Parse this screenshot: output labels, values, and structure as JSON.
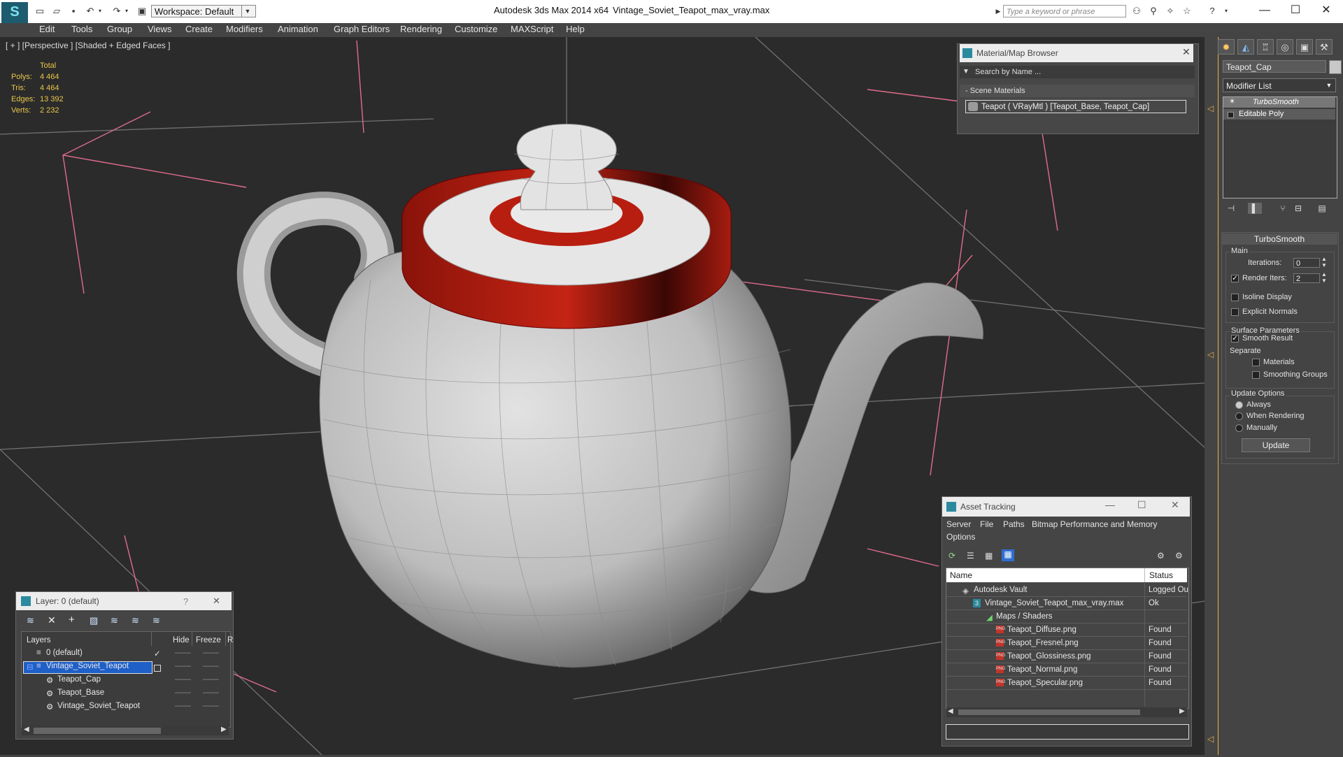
{
  "titlebar": {
    "workspace": "Workspace: Default",
    "app_title": "Autodesk 3ds Max  2014 x64",
    "file_title": "Vintage_Soviet_Teapot_max_vray.max",
    "search_placeholder": "Type a keyword or phrase",
    "minimize": "—",
    "maximize": "☐",
    "close": "✕"
  },
  "menu": [
    "Edit",
    "Tools",
    "Group",
    "Views",
    "Create",
    "Modifiers",
    "Animation",
    "Graph Editors",
    "Rendering",
    "Customize",
    "MAXScript",
    "Help"
  ],
  "viewport": {
    "label": "[ + ] [Perspective ] [Shaded + Edged Faces ]",
    "stats_header": "Total",
    "stats": [
      {
        "label": "Polys:",
        "value": "4 464"
      },
      {
        "label": "Tris:",
        "value": "4 464"
      },
      {
        "label": "Edges:",
        "value": "13 392"
      },
      {
        "label": "Verts:",
        "value": "2 232"
      }
    ],
    "colors": {
      "background": "#2b2b2b",
      "grid": "#a8a8a8",
      "rim": "#a81c10",
      "helper": "#e06c8c"
    }
  },
  "material_browser": {
    "title": "Material/Map Browser",
    "search": "Search by Name ...",
    "section": "- Scene Materials",
    "item": "Teapot  ( VRayMtl )  [Teapot_Base, Teapot_Cap]"
  },
  "command_panel": {
    "object_name": "Teapot_Cap",
    "modifier_list": "Modifier List",
    "stack": [
      "TurboSmooth",
      "Editable Poly"
    ],
    "rollout_title": "TurboSmooth",
    "main_group": "Main",
    "iterations_label": "Iterations:",
    "iterations_value": "0",
    "render_iters_label": "Render Iters:",
    "render_iters_value": "2",
    "isoline_display": "Isoline Display",
    "explicit_normals": "Explicit Normals",
    "surface_params": "Surface Parameters",
    "smooth_result": "Smooth Result",
    "separate": "Separate",
    "materials": "Materials",
    "smoothing_groups": "Smoothing Groups",
    "update_options": "Update Options",
    "always": "Always",
    "when_rendering": "When Rendering",
    "manually": "Manually",
    "update": "Update",
    "checked": {
      "render_iters": true,
      "isoline_display": false,
      "explicit_normals": false,
      "smooth_result": true,
      "materials": false,
      "smoothing_groups": false
    },
    "update_option_selected": "Always"
  },
  "asset_tracking": {
    "title": "Asset Tracking",
    "menus": [
      "Server",
      "File",
      "Paths",
      "Bitmap Performance and Memory"
    ],
    "menu_options": "Options",
    "columns": {
      "name": "Name",
      "status": "Status"
    },
    "rows": [
      {
        "name": "Autodesk Vault",
        "status": "Logged Ou"
      },
      {
        "name": "Vintage_Soviet_Teapot_max_vray.max",
        "status": "Ok"
      },
      {
        "name": "Maps / Shaders",
        "status": ""
      },
      {
        "name": "Teapot_Diffuse.png",
        "status": "Found"
      },
      {
        "name": "Teapot_Fresnel.png",
        "status": "Found"
      },
      {
        "name": "Teapot_Glossiness.png",
        "status": "Found"
      },
      {
        "name": "Teapot_Normal.png",
        "status": "Found"
      },
      {
        "name": "Teapot_Specular.png",
        "status": "Found"
      }
    ]
  },
  "layers": {
    "title": "Layer: 0 (default)",
    "help": "?",
    "close": "✕",
    "columns": {
      "layers": "Layers",
      "hide": "Hide",
      "freeze": "Freeze",
      "render": "R"
    },
    "rows": [
      {
        "name": "0 (default)",
        "selected": false
      },
      {
        "name": "Vintage_Soviet_Teapot",
        "selected": true
      },
      {
        "name": "Teapot_Cap",
        "selected": false
      },
      {
        "name": "Teapot_Base",
        "selected": false
      },
      {
        "name": "Vintage_Soviet_Teapot",
        "selected": false
      }
    ],
    "dash": "——"
  }
}
